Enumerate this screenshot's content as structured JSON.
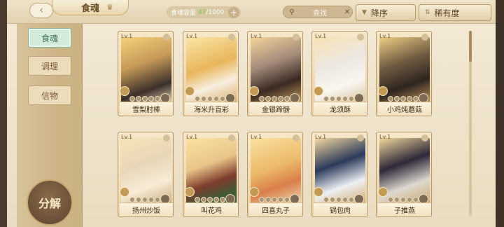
{
  "header": {
    "title": "食魂",
    "capacity_label": "食魂容量",
    "capacity_current": "47",
    "capacity_max": "/1000",
    "search_placeholder": "查找",
    "sort_order": "降序",
    "sort_by": "稀有度"
  },
  "sidebar": {
    "tabs": [
      {
        "label": "食魂",
        "active": true
      },
      {
        "label": "调理",
        "active": false
      },
      {
        "label": "信物",
        "active": false
      }
    ],
    "decompose_label": "分解"
  },
  "cards": [
    {
      "level": "Lv.1",
      "name": "雪梨肘棒"
    },
    {
      "level": "Lv.1",
      "name": "海米升百彩"
    },
    {
      "level": "Lv.1",
      "name": "金银蹄髈"
    },
    {
      "level": "Lv.1",
      "name": "龙须酥"
    },
    {
      "level": "Lv.1",
      "name": "小鸡炖蘑菇"
    },
    {
      "level": "Lv.1",
      "name": "扬州炒饭"
    },
    {
      "level": "Lv.1",
      "name": "叫花鸡"
    },
    {
      "level": "Lv.1",
      "name": "四喜丸子"
    },
    {
      "level": "Lv.1",
      "name": "锅包肉"
    },
    {
      "level": "Lv.1",
      "name": "子推燕"
    }
  ],
  "icons": {
    "back": "back-arrow-icon",
    "crown": "crown-icon",
    "search": "search-icon",
    "clear": "clear-icon",
    "sort": "sort-icon"
  },
  "colors": {
    "active_tab": "#d2ecd9",
    "accent": "#b99b68"
  }
}
